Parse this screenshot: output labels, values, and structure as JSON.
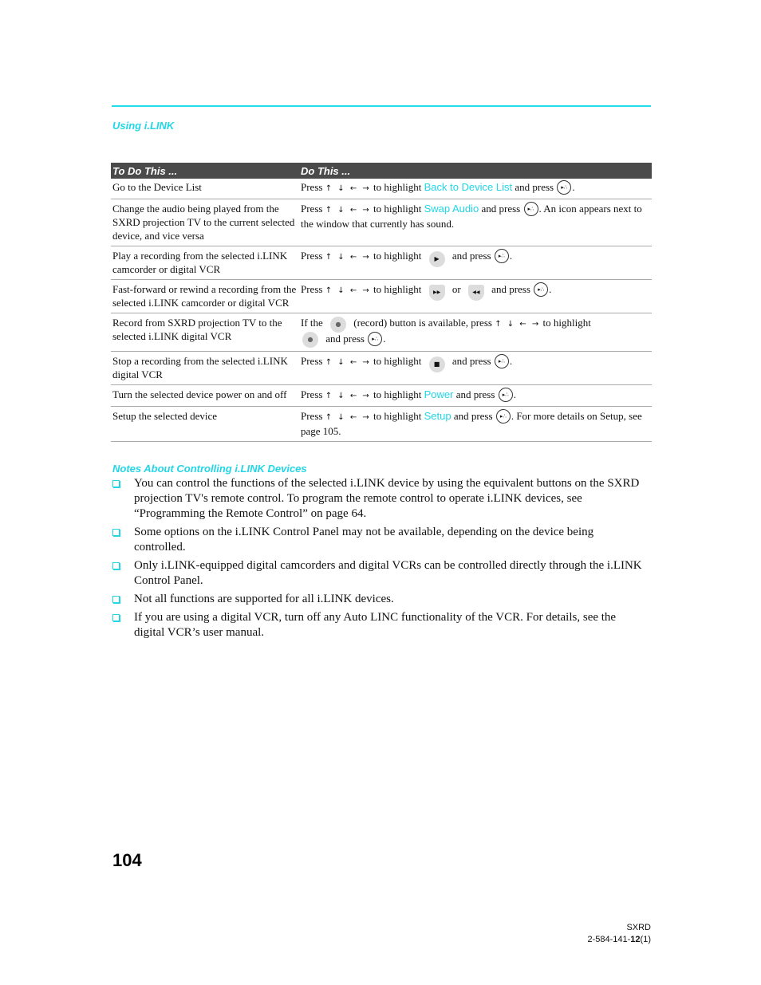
{
  "header": {
    "section_title": "Using i.LINK"
  },
  "table": {
    "headers": [
      "To Do This ...",
      "Do This ..."
    ],
    "arrows": "↑ ↓ ← →",
    "rows": [
      {
        "task": "Go to the Device List",
        "pre": "Press",
        "mid": "to highlight",
        "highlight": "Back to Device List",
        "post": "and press",
        "tail": "."
      },
      {
        "task": "Change the audio being played from the SXRD projection TV to the current selected device, and vice versa",
        "pre": "Press",
        "mid": "to highlight",
        "highlight": "Swap Audio",
        "post": "and press",
        "tail": ". An icon appears next to the window that currently has sound."
      },
      {
        "task": "Play a recording from the selected i.LINK camcorder or digital VCR",
        "pre": "Press",
        "mid": "to highlight",
        "button_icon": "play-icon",
        "post": "and press",
        "tail": "."
      },
      {
        "task": "Fast-forward or rewind a recording from the selected i.LINK camcorder or digital VCR",
        "pre": "Press",
        "mid": "to highlight",
        "button_icon": "fast-forward-icon",
        "or": "or",
        "button_icon_2": "rewind-icon",
        "post": "and press",
        "tail": "."
      },
      {
        "task": "Record from SXRD projection TV to the selected i.LINK digital VCR",
        "pre": "If the",
        "button_icon": "record-icon",
        "mid": "(record) button is available, press",
        "mid2": "to highlight",
        "post": "and press",
        "tail": "."
      },
      {
        "task": "Stop a recording from the selected i.LINK digital VCR",
        "pre": "Press",
        "mid": "to highlight",
        "button_icon": "stop-icon",
        "post": "and press",
        "tail": "."
      },
      {
        "task": "Turn the selected device power on and off",
        "pre": "Press",
        "mid": "to highlight",
        "highlight": "Power",
        "post": "and press",
        "tail": "."
      },
      {
        "task": "Setup the selected device",
        "pre": "Press",
        "mid": "to highlight",
        "highlight": "Setup",
        "post": "and press",
        "tail": ". For more details on Setup, see page 105."
      }
    ]
  },
  "notes": {
    "title": "Notes About Controlling i.LINK Devices",
    "items": [
      "You can control the functions of the selected i.LINK device by using the equivalent buttons on the SXRD projection TV's remote control. To program the remote control to operate i.LINK devices, see “Programming the Remote Control” on page 64.",
      "Some options on the i.LINK Control Panel may not be available, depending on the device being controlled.",
      "Only i.LINK-equipped digital camcorders and digital VCRs can be controlled directly through the i.LINK Control Panel.",
      "Not all functions are supported for all i.LINK devices.",
      "If you are using a digital VCR, turn off any Auto LINC functionality of the VCR. For details, see the digital VCR’s user manual."
    ]
  },
  "footer": {
    "page_number": "104",
    "model": "SXRD",
    "doc_code_prefix": "2-584-141-",
    "doc_code_bold": "12",
    "doc_code_suffix": "(1)"
  },
  "icons": {
    "enter_glyph": "▸∴",
    "play": "▶",
    "fast_forward": "▶▶",
    "rewind": "◀◀",
    "record": "●",
    "stop": "■"
  },
  "colors": {
    "accent": "#22d6e6",
    "header_bg": "#4a4a4a"
  }
}
